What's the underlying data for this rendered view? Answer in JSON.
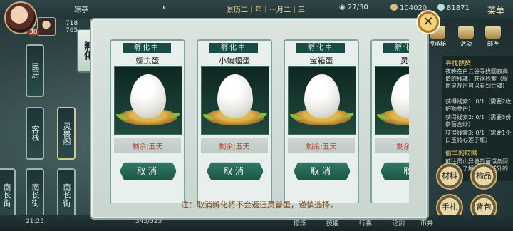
{
  "topbar": {
    "location": "凉亭",
    "date": "景历二十年十一月二十三",
    "stamina": "27/30",
    "money": "104020",
    "jade": "81871",
    "menu": "菜单"
  },
  "player": {
    "level": "38",
    "hp": "718",
    "mp": "765"
  },
  "side_tab": "孵化",
  "map_nodes": [
    "民居",
    "客栈",
    "灵兽阁",
    "南长街",
    "南长街",
    "南长街"
  ],
  "top_icons": [
    "传承秘",
    "活动",
    "邮件"
  ],
  "cards": [
    {
      "status": "孵化中",
      "name": "蠕虫蛋",
      "remain": "剩余:五天",
      "button": "取消"
    },
    {
      "status": "孵化中",
      "name": "小蝙蝠蛋",
      "remain": "剩余:五天",
      "button": "取消"
    },
    {
      "status": "孵化中",
      "name": "宝箱蛋",
      "remain": "剩余:五天",
      "button": "取消"
    },
    {
      "status": "孵化中",
      "name": "灵獸",
      "remain": "剩余:五",
      "button": "取"
    }
  ],
  "note": "注：取消孵化将不会返还灵兽蛋，谨慎选择。",
  "quest": {
    "title1": "寻找琵琶",
    "text1": "夜晚在白云谷寻找圆寂高僧的残魂，获得线索（服用灵视丹可以看到亡魂）",
    "clue1": "获得线索1: 0/1（需要2枚护额金丹）",
    "clue2": "获得线索2: 0/1（需要3份杂菌合炒）",
    "clue3": "获得线索3: 0/1（需要1个白玉转心莲子瓶）",
    "title2": "偷羊的窃贼",
    "text2": "前往灵山异兽的菌馔条问问那，了解被刁鱼城外的刁"
  },
  "right_buttons": [
    "材料",
    "物品",
    "手札",
    "背包"
  ],
  "bottombar": {
    "time": "21:25",
    "exp": "345/525",
    "labels": [
      "修炼",
      "技能",
      "行囊",
      "论剑",
      "市井"
    ]
  }
}
